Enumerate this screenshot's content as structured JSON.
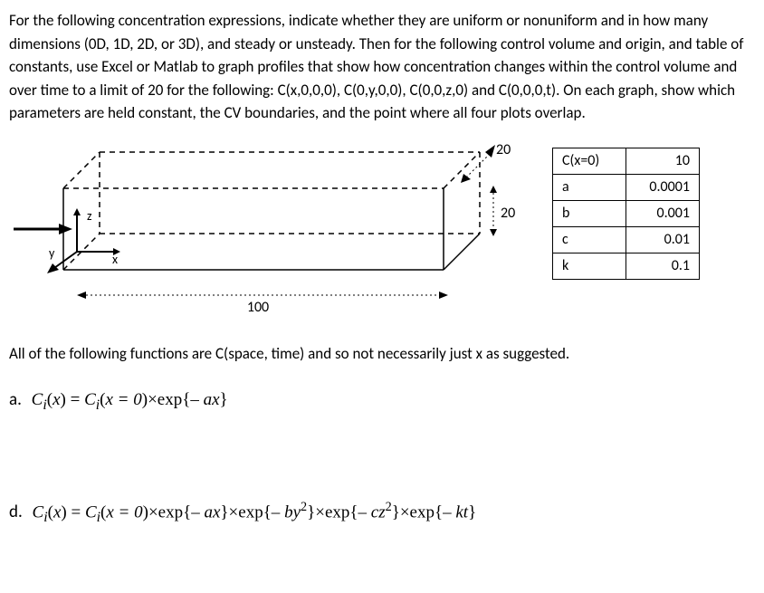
{
  "intro": "For the following concentration expressions, indicate whether they are uniform or nonuniform and in how many dimensions (0D, 1D, 2D, or 3D), and steady or unsteady. Then for the following control volume and origin, and table of constants, use Excel or Matlab to graph profiles that show how concentration changes within the control volume and over time to a limit of 20 for the following: C(x,0,0,0), C(0,y,0,0), C(0,0,z,0) and C(0,0,0,t). On each graph, show which parameters are held constant, the CV boundaries, and the point where all four plots overlap.",
  "diagram": {
    "axes": {
      "x": "x",
      "y": "y",
      "z": "z"
    },
    "dim_height": "20",
    "dim_depth": "20",
    "dim_length": "100"
  },
  "constants": {
    "rows": [
      {
        "label": "C(x=0)",
        "value": "10"
      },
      {
        "label": "a",
        "value": "0.0001"
      },
      {
        "label": "b",
        "value": "0.001"
      },
      {
        "label": "c",
        "value": "0.01"
      },
      {
        "label": "k",
        "value": "0.1"
      }
    ]
  },
  "note": "All of the following functions are C(space, time) and so not necessarily just x as suggested.",
  "eq_a": {
    "label": "a.",
    "lhs_var": "C",
    "lhs_sub": "i",
    "lhs_arg": "x",
    "rhs_c": "C",
    "rhs_csub": "i",
    "rhs_cond": "x = 0",
    "t1": "ax"
  },
  "eq_d": {
    "label": "d.",
    "lhs_var": "C",
    "lhs_sub": "i",
    "lhs_arg": "x",
    "rhs_c": "C",
    "rhs_csub": "i",
    "rhs_cond": "x = 0",
    "t1": "ax",
    "t2": "by",
    "t3": "cz",
    "t4": "kt"
  }
}
